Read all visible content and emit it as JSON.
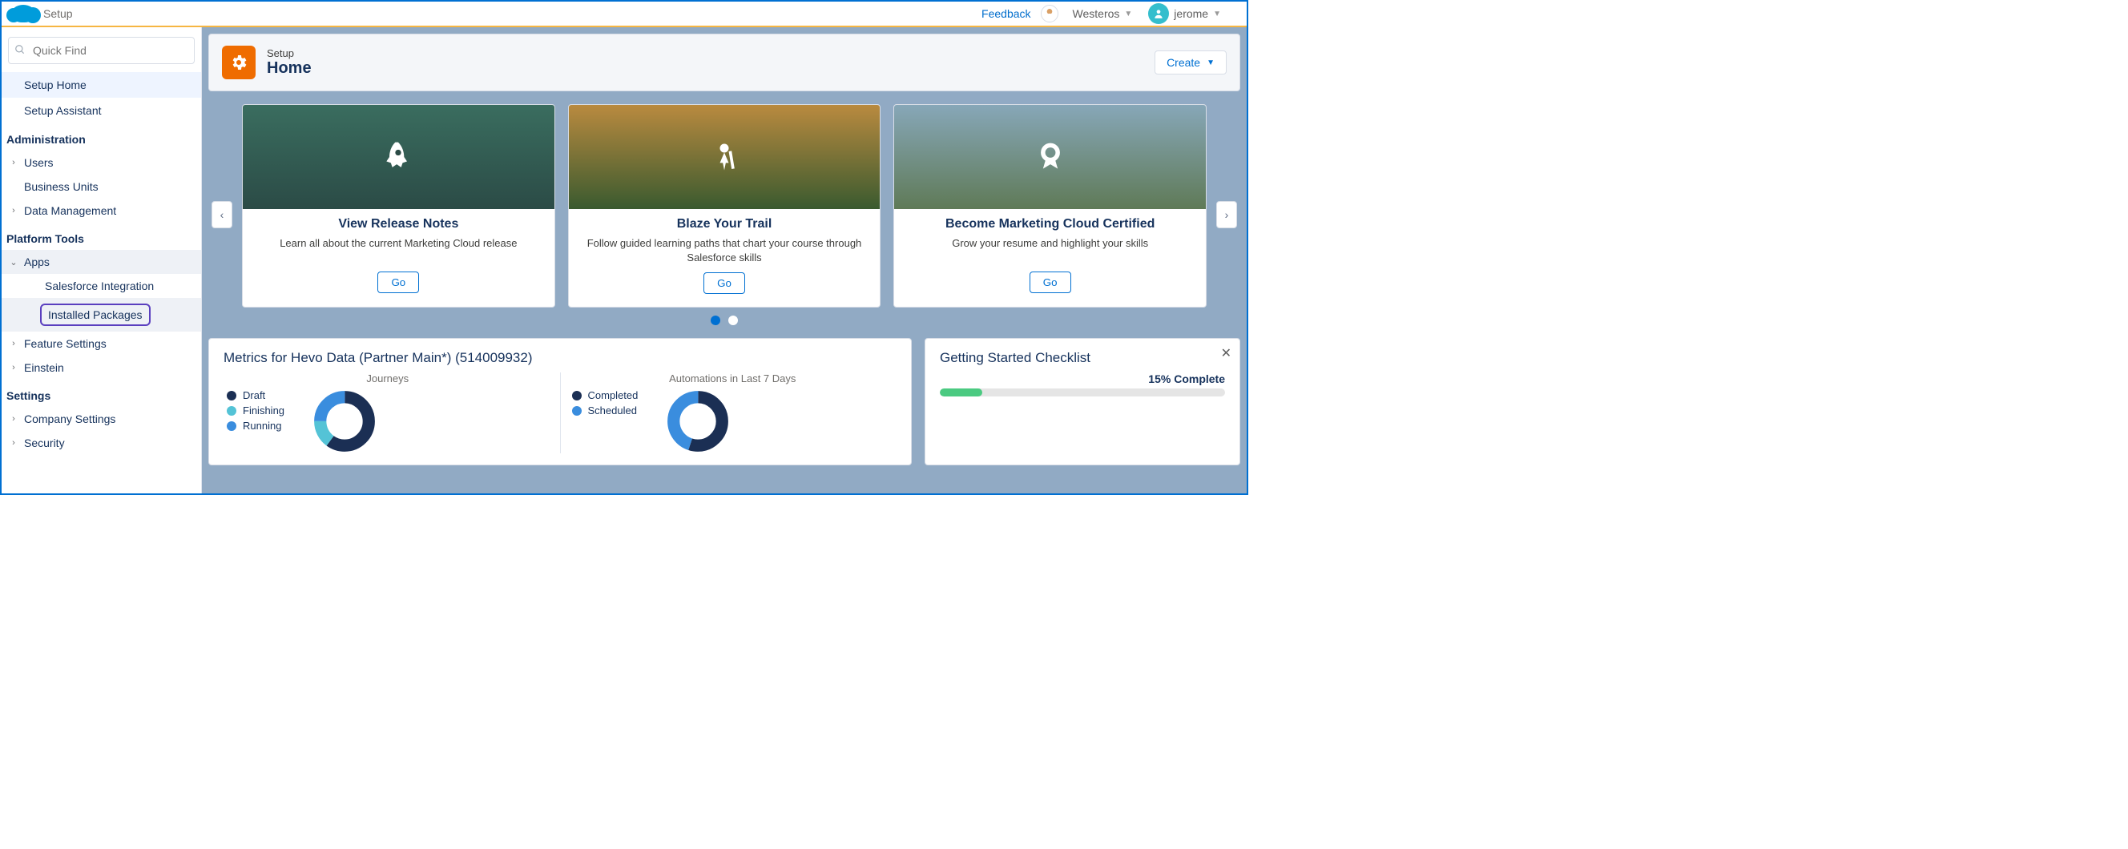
{
  "top": {
    "app_title": "Setup",
    "feedback": "Feedback",
    "org_name": "Westeros",
    "user_name": "jerome"
  },
  "sidebar": {
    "search_placeholder": "Quick Find",
    "setup_home": "Setup Home",
    "setup_assistant": "Setup Assistant",
    "section_admin": "Administration",
    "admin_items": {
      "users": "Users",
      "bu": "Business Units",
      "data": "Data Management"
    },
    "section_platform": "Platform Tools",
    "apps": "Apps",
    "apps_children": {
      "sf_integration": "Salesforce Integration",
      "installed_packages": "Installed Packages"
    },
    "feature_settings": "Feature Settings",
    "einstein": "Einstein",
    "section_settings": "Settings",
    "company_settings": "Company Settings",
    "security": "Security"
  },
  "header": {
    "eyebrow": "Setup",
    "title": "Home",
    "create": "Create"
  },
  "carousel": {
    "cards": [
      {
        "title": "View Release Notes",
        "desc": "Learn all about the current Marketing Cloud release",
        "cta": "Go"
      },
      {
        "title": "Blaze Your Trail",
        "desc": "Follow guided learning paths that chart your course through Salesforce skills",
        "cta": "Go"
      },
      {
        "title": "Become Marketing Cloud Certified",
        "desc": "Grow your resume and highlight your skills",
        "cta": "Go"
      }
    ]
  },
  "metrics": {
    "title": "Metrics for Hevo Data (Partner Main*) (514009932)",
    "journeys": {
      "label": "Journeys",
      "legend": [
        "Draft",
        "Finishing",
        "Running"
      ],
      "colors": [
        "#1b2f54",
        "#54c3d6",
        "#3a8dde"
      ]
    },
    "automations": {
      "label": "Automations in Last 7 Days",
      "legend": [
        "Completed",
        "Scheduled"
      ],
      "colors": [
        "#1b2f54",
        "#3a8dde"
      ]
    }
  },
  "checklist": {
    "title": "Getting Started Checklist",
    "percent_label": "15% Complete",
    "percent": 15
  }
}
